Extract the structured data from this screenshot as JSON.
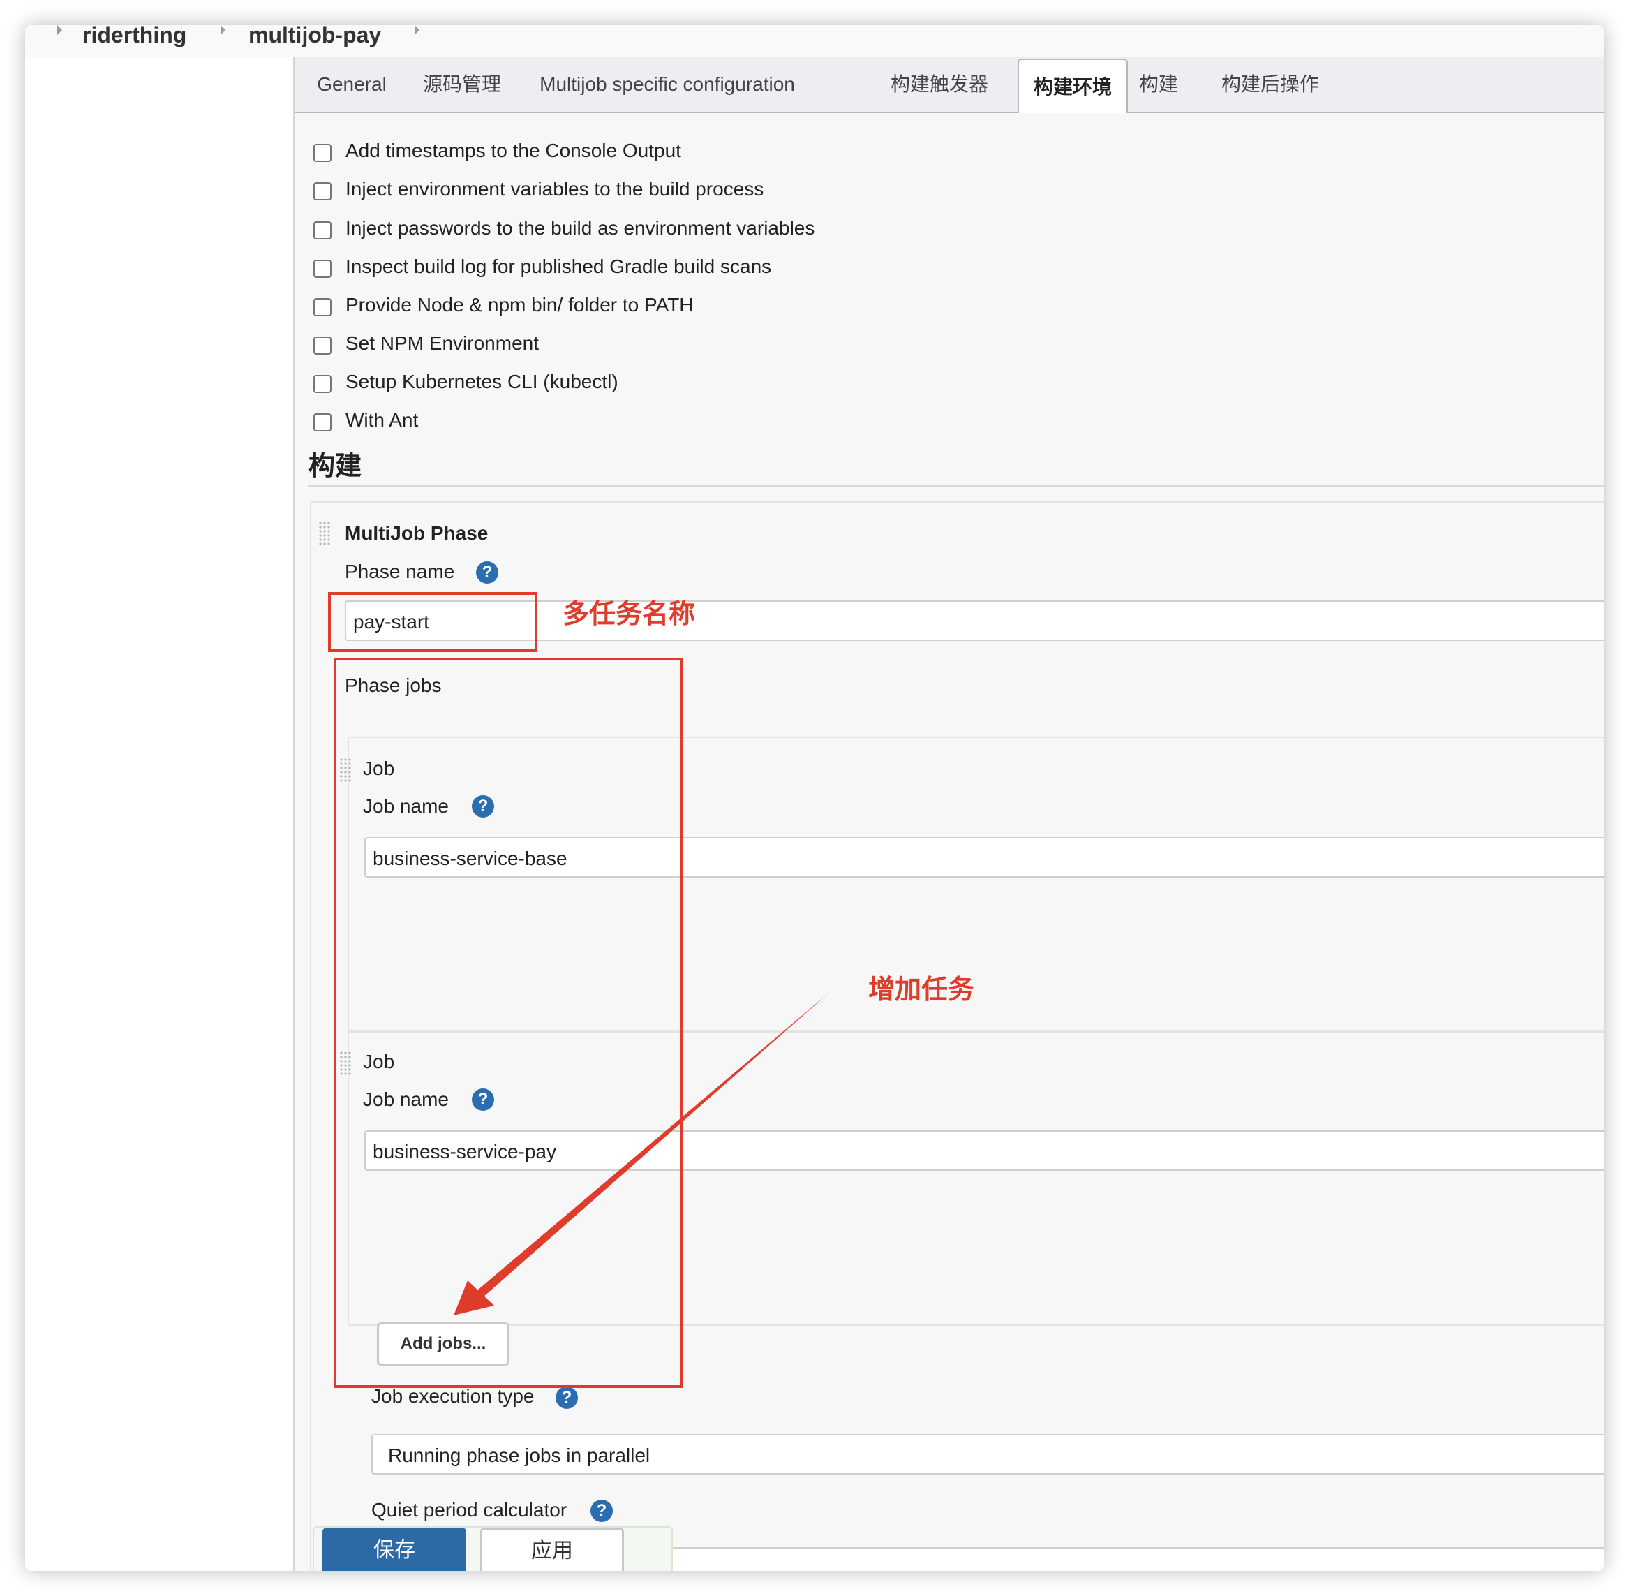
{
  "breadcrumb": {
    "items": [
      "riderthing",
      "multijob-pay"
    ]
  },
  "tabs": [
    {
      "label": "General",
      "active": false
    },
    {
      "label": "源码管理",
      "active": false
    },
    {
      "label": "Multijob specific configuration",
      "active": false
    },
    {
      "label": "构建触发器",
      "active": false
    },
    {
      "label": "构建环境",
      "active": true
    },
    {
      "label": "构建",
      "active": false
    },
    {
      "label": "构建后操作",
      "active": false
    }
  ],
  "build_env": {
    "options": [
      {
        "label": "Add timestamps to the Console Output",
        "checked": false
      },
      {
        "label": "Inject environment variables to the build process",
        "checked": false
      },
      {
        "label": "Inject passwords to the build as environment variables",
        "checked": false
      },
      {
        "label": "Inspect build log for published Gradle build scans",
        "checked": false
      },
      {
        "label": "Provide Node & npm bin/ folder to PATH",
        "checked": false
      },
      {
        "label": "Set NPM Environment",
        "checked": false
      },
      {
        "label": "Setup Kubernetes CLI (kubectl)",
        "checked": false
      },
      {
        "label": "With Ant",
        "checked": false
      }
    ]
  },
  "build": {
    "section_title": "构建",
    "phase": {
      "title": "MultiJob Phase",
      "phase_name_label": "Phase name",
      "phase_name_value": "pay-start",
      "phase_jobs_label": "Phase jobs",
      "jobs": [
        {
          "title": "Job",
          "name_label": "Job name",
          "name_value": "business-service-base"
        },
        {
          "title": "Job",
          "name_label": "Job name",
          "name_value": "business-service-pay"
        }
      ],
      "add_jobs_label": "Add jobs...",
      "execution_type_label": "Job execution type",
      "execution_type_value": "Running phase jobs in parallel",
      "quiet_period_label": "Quiet period calculator"
    }
  },
  "help_glyph": "?",
  "actions": {
    "save_label": "保存",
    "apply_label": "应用"
  },
  "annotations": {
    "phase_name_note": "多任务名称",
    "add_jobs_note": "增加任务",
    "color": "#e03c2c"
  },
  "colors": {
    "primary_button": "#2c6aa6",
    "help_icon": "#2a6db0"
  }
}
